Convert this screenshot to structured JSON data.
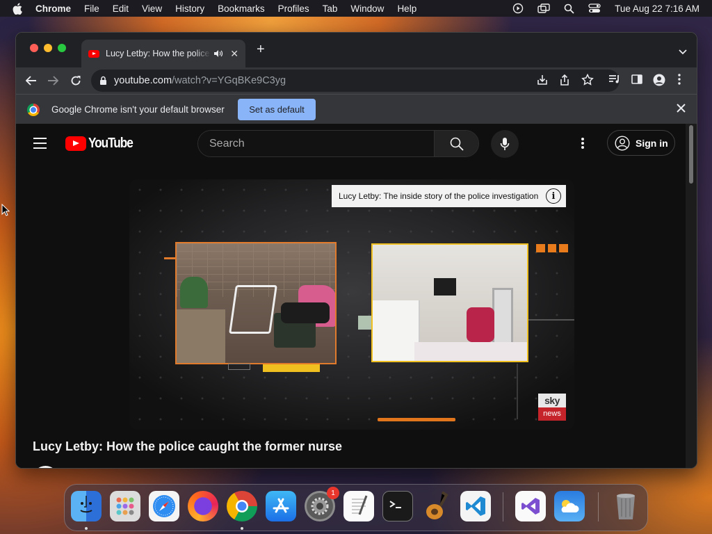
{
  "menubar": {
    "app_name": "Chrome",
    "items": [
      "File",
      "Edit",
      "View",
      "History",
      "Bookmarks",
      "Profiles",
      "Tab",
      "Window",
      "Help"
    ],
    "datetime": "Tue Aug 22  7:16 AM"
  },
  "browser": {
    "tab_title": "Lucy Letby: How the police caught the former nurse",
    "url_domain": "youtube.com",
    "url_path": "/watch?v=YGqBKe9C3yg",
    "infobar_message": "Google Chrome isn't your default browser",
    "infobar_button": "Set as default"
  },
  "youtube": {
    "logo_text": "YouTube",
    "search_placeholder": "Search",
    "signin_label": "Sign in",
    "player_info_title": "Lucy Letby: The inside story of the police investigation",
    "channel_logo_top": "sky",
    "channel_logo_bottom": "news",
    "video_title": "Lucy Letby: How the police caught the former nurse"
  },
  "dock": {
    "apps": [
      "finder",
      "launchpad",
      "safari",
      "firefox",
      "chrome",
      "app-store",
      "system-settings",
      "textedit",
      "terminal",
      "garageband",
      "vscode",
      "visual-studio",
      "weather",
      "trash"
    ],
    "system_settings_badge": "1"
  },
  "colors": {
    "youtube_red": "#ff0000",
    "chrome_blue_button": "#8ab4f8",
    "frame_orange": "#e27a2c",
    "frame_yellow": "#f0c020",
    "sky_red": "#c4242a"
  }
}
